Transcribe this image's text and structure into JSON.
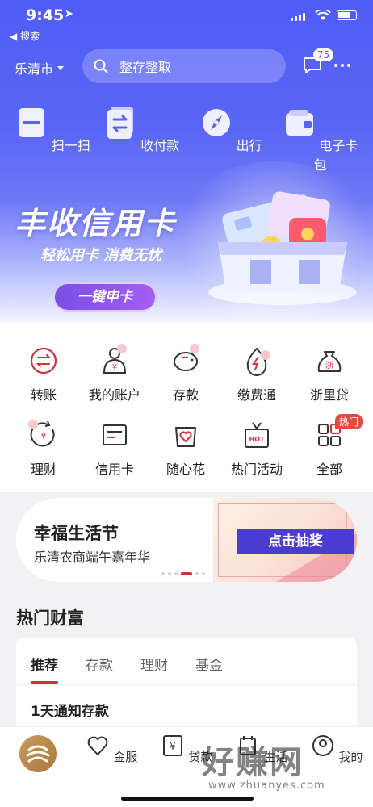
{
  "status_bar": {
    "time": "9:45",
    "back_label": "◀ 搜索"
  },
  "header": {
    "city": "乐清市",
    "search_placeholder": "整存整取",
    "message_count": "75"
  },
  "quick_actions": [
    {
      "label": "扫一扫",
      "icon": "scan-icon"
    },
    {
      "label": "收付款",
      "icon": "payment-icon"
    },
    {
      "label": "出行",
      "icon": "compass-icon"
    },
    {
      "label": "电子卡包",
      "icon": "wallet-icon"
    }
  ],
  "banner": {
    "title": "丰收信用卡",
    "subtitle": "轻松用卡 消费无忧",
    "button": "一键申卡"
  },
  "functions": [
    {
      "label": "转账",
      "icon": "transfer-icon"
    },
    {
      "label": "我的账户",
      "icon": "account-icon"
    },
    {
      "label": "存款",
      "icon": "piggy-bank-icon"
    },
    {
      "label": "缴费通",
      "icon": "bill-pay-icon"
    },
    {
      "label": "浙里贷",
      "icon": "loan-bag-icon"
    },
    {
      "label": "理财",
      "icon": "wealth-icon"
    },
    {
      "label": "信用卡",
      "icon": "credit-card-icon"
    },
    {
      "label": "随心花",
      "icon": "heart-bag-icon"
    },
    {
      "label": "热门活动",
      "icon": "gift-hot-icon"
    },
    {
      "label": "全部",
      "icon": "grid-icon"
    }
  ],
  "hot_badge": "热门",
  "promo": {
    "title": "幸福生活节",
    "subtitle": "乐清农商端午嘉年华",
    "button": "点击抽奖"
  },
  "hot_wealth": {
    "title": "热门财富",
    "tabs": [
      "推荐",
      "存款",
      "理财",
      "基金"
    ],
    "item": "1天通知存款"
  },
  "tabbar": [
    {
      "label": "",
      "icon": "home-logo-icon"
    },
    {
      "label": "金服",
      "icon": "heart-icon"
    },
    {
      "label": "贷款",
      "icon": "yuan-doc-icon"
    },
    {
      "label": "生活",
      "icon": "life-icon"
    },
    {
      "label": "我的",
      "icon": "profile-icon"
    }
  ],
  "watermark": {
    "text": "好赚网",
    "url": "www.zhuanyes.com"
  },
  "colors": {
    "brand_blue": "#5a62f0",
    "accent_red": "#d0323c",
    "promo_btn": "#4b3cd1"
  }
}
